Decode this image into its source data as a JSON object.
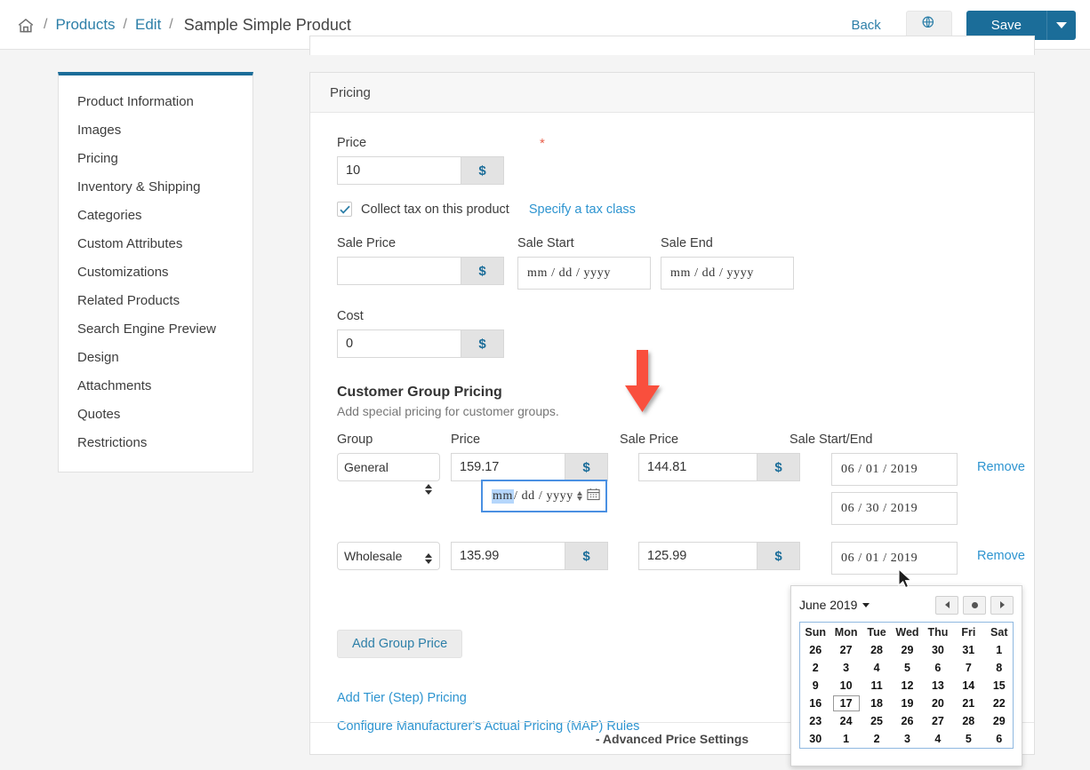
{
  "breadcrumb": {
    "home_icon": "home-icon",
    "sep": "/",
    "products": "Products",
    "edit": "Edit",
    "current": "Sample Simple Product"
  },
  "top_actions": {
    "back": "Back",
    "preview_icon": "globe-icon",
    "save": "Save",
    "save_caret_icon": "chevron-down-icon"
  },
  "sidebar": {
    "items": [
      {
        "label": "Product Information"
      },
      {
        "label": "Images"
      },
      {
        "label": "Pricing"
      },
      {
        "label": "Inventory & Shipping"
      },
      {
        "label": "Categories"
      },
      {
        "label": "Custom Attributes"
      },
      {
        "label": "Customizations"
      },
      {
        "label": "Related Products"
      },
      {
        "label": "Search Engine Preview"
      },
      {
        "label": "Design"
      },
      {
        "label": "Attachments"
      },
      {
        "label": "Quotes"
      },
      {
        "label": "Restrictions"
      }
    ]
  },
  "pricing": {
    "panel_title": "Pricing",
    "price_label": "Price",
    "price_required_marker": "*",
    "price_value": "10",
    "currency_symbol": "$",
    "collect_tax_label": "Collect tax on this product",
    "collect_tax_checked": true,
    "tax_class_link": "Specify a tax class",
    "sale_price_label": "Sale Price",
    "sale_price_value": "",
    "sale_start_label": "Sale Start",
    "sale_start_value": "mm / dd / yyyy",
    "sale_end_label": "Sale End",
    "sale_end_value": "mm / dd / yyyy",
    "cost_label": "Cost",
    "cost_value": "0"
  },
  "group_pricing": {
    "heading": "Customer Group Pricing",
    "subheading": "Add special pricing for customer groups.",
    "columns": {
      "group": "Group",
      "price": "Price",
      "sale_price": "Sale Price",
      "sale_dates": "Sale Start/End"
    },
    "rows": [
      {
        "group": "General",
        "price": "159.17",
        "sale_price": "144.81",
        "sale_start": "06 / 01 / 2019",
        "sale_end": "06 / 30 / 2019",
        "remove": "Remove"
      },
      {
        "group": "Wholesale",
        "price": "135.99",
        "sale_price": "125.99",
        "sale_start": "06 / 01 / 2019",
        "sale_end_placeholder": "mm / dd / yyyy",
        "sale_end_focused_segment": "mm",
        "sale_end_rest": " / dd / yyyy",
        "remove": "Remove"
      }
    ],
    "add_group_price": "Add Group Price",
    "tier_pricing_link": "Add Tier (Step) Pricing",
    "map_rules_link": "Configure Manufacturer's Actual Pricing (MAP) Rules"
  },
  "footer": {
    "advanced": "- Advanced Price Settings"
  },
  "datepicker": {
    "title": "June 2019",
    "title_caret_icon": "chevron-down-icon",
    "prev_icon": "chevron-left-icon",
    "today_icon": "dot-icon",
    "next_icon": "chevron-right-icon",
    "daynames": [
      "Sun",
      "Mon",
      "Tue",
      "Wed",
      "Thu",
      "Fri",
      "Sat"
    ],
    "weeks": [
      [
        {
          "d": "26",
          "muted": true
        },
        {
          "d": "27",
          "muted": true
        },
        {
          "d": "28",
          "muted": true
        },
        {
          "d": "29",
          "muted": true
        },
        {
          "d": "30",
          "muted": true
        },
        {
          "d": "31",
          "muted": true
        },
        {
          "d": "1",
          "muted": false
        }
      ],
      [
        {
          "d": "2"
        },
        {
          "d": "3"
        },
        {
          "d": "4"
        },
        {
          "d": "5"
        },
        {
          "d": "6"
        },
        {
          "d": "7"
        },
        {
          "d": "8"
        }
      ],
      [
        {
          "d": "9"
        },
        {
          "d": "10"
        },
        {
          "d": "11"
        },
        {
          "d": "12"
        },
        {
          "d": "13"
        },
        {
          "d": "14"
        },
        {
          "d": "15"
        }
      ],
      [
        {
          "d": "16"
        },
        {
          "d": "17",
          "today": true
        },
        {
          "d": "18"
        },
        {
          "d": "19"
        },
        {
          "d": "20"
        },
        {
          "d": "21"
        },
        {
          "d": "22"
        }
      ],
      [
        {
          "d": "23"
        },
        {
          "d": "24"
        },
        {
          "d": "25"
        },
        {
          "d": "26"
        },
        {
          "d": "27"
        },
        {
          "d": "28"
        },
        {
          "d": "29"
        }
      ],
      [
        {
          "d": "30"
        },
        {
          "d": "1",
          "muted": true
        },
        {
          "d": "2",
          "muted": true
        },
        {
          "d": "3",
          "muted": true
        },
        {
          "d": "4",
          "muted": true
        },
        {
          "d": "5",
          "muted": true
        },
        {
          "d": "6",
          "muted": true
        }
      ]
    ]
  },
  "annotation": {
    "arrow_icon": "down-arrow-annotation",
    "arrow_color": "#f9503e"
  },
  "colors": {
    "accent": "#1b6d99",
    "link": "#2d94d0",
    "required": "#e8604c",
    "page_bg": "#f4f4f4"
  }
}
